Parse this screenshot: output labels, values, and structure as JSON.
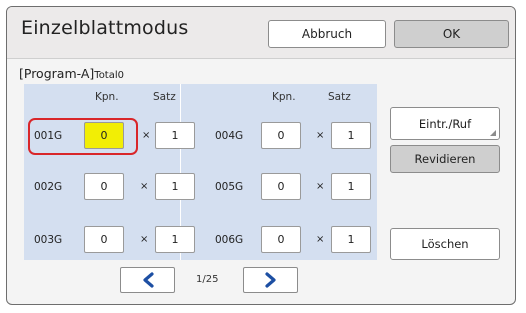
{
  "header": {
    "title": "Einzelblattmodus",
    "cancel_label": "Abbruch",
    "ok_label": "OK"
  },
  "program": {
    "name": "[Program-A]",
    "total": "Total0"
  },
  "columns": {
    "left": {
      "copies": "Kpn.",
      "sets": "Satz"
    },
    "right": {
      "copies": "Kpn.",
      "sets": "Satz"
    }
  },
  "multiply_sign": "×",
  "groups": [
    {
      "label": "001G",
      "copies": "0",
      "sets": "1",
      "selected": true
    },
    {
      "label": "002G",
      "copies": "0",
      "sets": "1"
    },
    {
      "label": "003G",
      "copies": "0",
      "sets": "1"
    },
    {
      "label": "004G",
      "copies": "0",
      "sets": "1"
    },
    {
      "label": "005G",
      "copies": "0",
      "sets": "1"
    },
    {
      "label": "006G",
      "copies": "0",
      "sets": "1"
    }
  ],
  "side_buttons": {
    "entry_recall": "Eintr./Ruf",
    "revise": "Revidieren",
    "delete": "Löschen"
  },
  "pager": {
    "page": "1/25",
    "prev_icon": "chevron-left-icon",
    "next_icon": "chevron-right-icon"
  },
  "colors": {
    "accent_blue": "#1d4fa3",
    "selected_field": "#f2ee05",
    "highlight_border": "#d9262a",
    "grid_background": "#d4dff0"
  }
}
